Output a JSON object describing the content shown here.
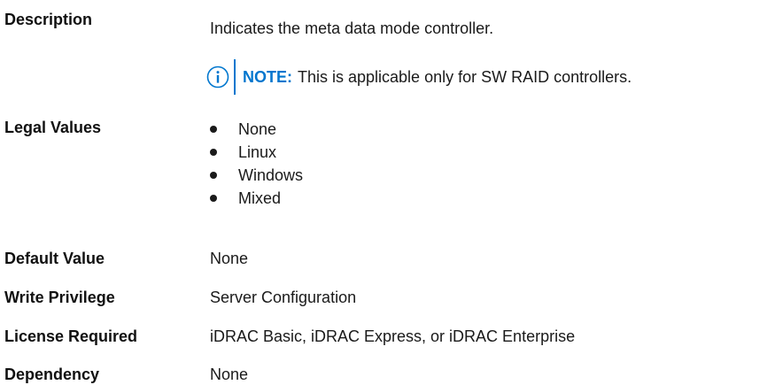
{
  "description": {
    "label": "Description",
    "text": "Indicates the meta data mode controller.",
    "note": {
      "icon": "info-circle-icon",
      "label": "NOTE:",
      "text": "This is applicable only for SW RAID controllers."
    }
  },
  "legal_values": {
    "label": "Legal Values",
    "items": [
      "None",
      "Linux",
      "Windows",
      "Mixed"
    ]
  },
  "default_value": {
    "label": "Default Value",
    "value": "None"
  },
  "write_privilege": {
    "label": "Write Privilege",
    "value": "Server Configuration"
  },
  "license_required": {
    "label": "License Required",
    "value": "iDRAC Basic, iDRAC Express, or iDRAC Enterprise"
  },
  "dependency": {
    "label": "Dependency",
    "value": "None"
  },
  "colors": {
    "accent": "#0076ce",
    "text": "#1a1a1a"
  }
}
